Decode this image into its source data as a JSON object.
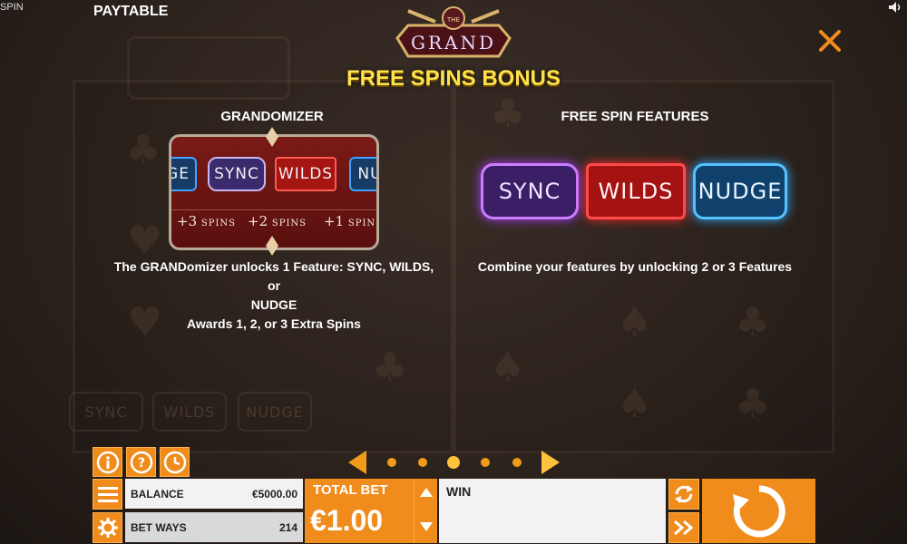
{
  "header": {
    "corner_label": "SPIN",
    "title": "PAYTABLE",
    "logo_text": "THE GRAND",
    "bonus_title": "FREE SPINS BONUS"
  },
  "background": {
    "features": [
      "SYNC",
      "WILDS",
      "NUDGE"
    ]
  },
  "grandomizer": {
    "title": "GRANDOMIZER",
    "badges": [
      "GE",
      "SYNC",
      "WILDS",
      "NU"
    ],
    "spins": [
      {
        "num": "+3",
        "unit": "SPINS"
      },
      {
        "num": "+2",
        "unit": "SPINS"
      },
      {
        "num": "+1",
        "unit": "SPIN"
      }
    ],
    "desc_line1": "The GRANDomizer unlocks 1 Feature: SYNC, WILDS, or",
    "desc_line2": "NUDGE",
    "desc_line3": "Awards 1, 2, or 3 Extra Spins"
  },
  "free_spin_features": {
    "title": "FREE SPIN FEATURES",
    "badges": [
      {
        "label": "SYNC",
        "color": "#b34dff"
      },
      {
        "label": "WILDS",
        "color": "#ff2b2b"
      },
      {
        "label": "NUDGE",
        "color": "#2fa8ff"
      }
    ],
    "desc": "Combine your features by unlocking 2 or 3 Features"
  },
  "pager": {
    "pages": 5,
    "active_index": 2
  },
  "bottom_bar": {
    "balance_label": "BALANCE",
    "balance_value": "€5000.00",
    "betways_label": "BET WAYS",
    "betways_value": "214",
    "totalbet_label": "TOTAL BET",
    "totalbet_value": "€1.00",
    "win_label": "WIN"
  },
  "colors": {
    "accent": "#f08c1c",
    "title_yellow": "#ffe14a"
  },
  "icons": [
    "info-icon",
    "help-icon",
    "history-icon",
    "menu-icon",
    "settings-icon",
    "autoplay-icon",
    "fast-forward-icon",
    "spin-icon",
    "close-icon",
    "sound-icon"
  ]
}
